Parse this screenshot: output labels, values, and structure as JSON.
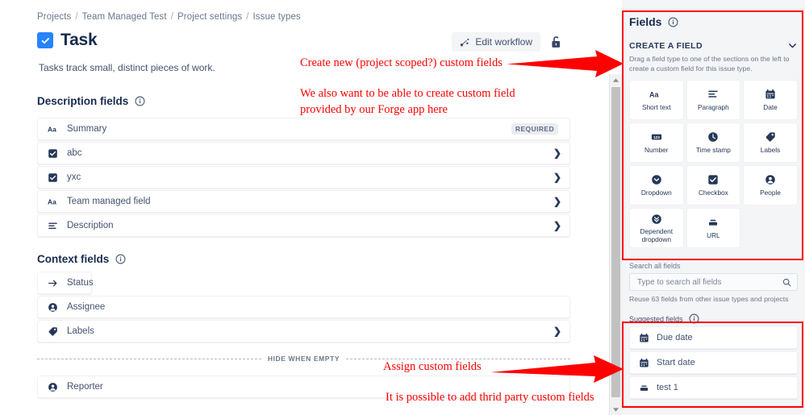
{
  "breadcrumb": [
    "Projects",
    "Team Managed Test",
    "Project settings",
    "Issue types"
  ],
  "header": {
    "title": "Task",
    "subtitle": "Tasks track small, distinct pieces of work.",
    "edit_workflow_label": "Edit workflow",
    "lock_icon": "padlock-unlocked-icon",
    "workflow_icon": "workflow-nodes-icon",
    "check_icon": "task-checkbox-icon"
  },
  "description_section": {
    "title": "Description fields",
    "info_icon": "info-circle-icon",
    "rows": [
      {
        "label": "Summary",
        "icon": "text-aa-icon",
        "badge": "REQUIRED",
        "chevron": false,
        "full": true
      },
      {
        "label": "abc",
        "icon": "checkbox-icon",
        "badge": "",
        "chevron": true,
        "full": true
      },
      {
        "label": "yxc",
        "icon": "checkbox-icon",
        "badge": "",
        "chevron": true,
        "full": true
      },
      {
        "label": "Team managed field",
        "icon": "text-aa-icon",
        "badge": "",
        "chevron": true,
        "full": true
      },
      {
        "label": "Description",
        "icon": "paragraph-icon",
        "badge": "",
        "chevron": true,
        "full": true
      }
    ]
  },
  "context_section": {
    "title": "Context fields",
    "info_icon": "info-circle-icon",
    "rows_top": [
      {
        "label": "Status",
        "icon": "arrow-right-icon",
        "badge": "",
        "chevron": false,
        "full": false
      },
      {
        "label": "Assignee",
        "icon": "person-icon",
        "badge": "",
        "chevron": false,
        "full": true
      },
      {
        "label": "Labels",
        "icon": "label-tag-icon",
        "badge": "",
        "chevron": true,
        "full": true
      }
    ],
    "divider_label": "HIDE WHEN EMPTY",
    "rows_bottom": [
      {
        "label": "Reporter",
        "icon": "person-icon",
        "badge": "",
        "chevron": false,
        "full": true
      }
    ]
  },
  "panel": {
    "title": "Fields",
    "info_icon": "info-circle-icon",
    "create_a_field": "CREATE A FIELD",
    "collapse_icon": "chevron-down-icon",
    "create_description": "Drag a field type to one of the sections on the left to create a custom field for this issue type.",
    "field_types": [
      {
        "label": "Short text",
        "icon": "text-aa-icon"
      },
      {
        "label": "Paragraph",
        "icon": "paragraph-icon"
      },
      {
        "label": "Date",
        "icon": "calendar-icon"
      },
      {
        "label": "Number",
        "icon": "number-123-icon"
      },
      {
        "label": "Time stamp",
        "icon": "clock-icon"
      },
      {
        "label": "Labels",
        "icon": "label-tag-icon"
      },
      {
        "label": "Dropdown",
        "icon": "chevron-down-circle-icon"
      },
      {
        "label": "Checkbox",
        "icon": "checkbox-icon"
      },
      {
        "label": "People",
        "icon": "person-circle-icon"
      },
      {
        "label": "Dependent dropdown",
        "icon": "double-chevron-down-circle-icon"
      },
      {
        "label": "URL",
        "icon": "link-url-icon"
      }
    ],
    "search_label": "Search all fields",
    "search_placeholder": "Type to search all fields",
    "search_value": "",
    "search_icon": "search-icon",
    "reuse_text": "Reuse 63 fields from other issue types and projects",
    "suggested_title": "Suggested fields",
    "suggested_info_icon": "info-circle-icon",
    "suggested": [
      {
        "label": "Due date",
        "icon": "calendar-icon"
      },
      {
        "label": "Start date",
        "icon": "calendar-icon"
      },
      {
        "label": "test 1",
        "icon": "link-url-icon"
      }
    ]
  },
  "annotations": [
    {
      "text": "Create new (project scoped?) custom fields"
    },
    {
      "text": "We also want to be able to create custom field"
    },
    {
      "text": " provided by our Forge app here"
    },
    {
      "text": "Assign custom fields"
    },
    {
      "text": "It is possible to add thrid party custom fields"
    }
  ],
  "colors": {
    "annotation_red": "#FF0000",
    "accent_blue": "#2684FF",
    "text_dark": "#172B4D",
    "panel_bg": "#F4F5F7"
  }
}
